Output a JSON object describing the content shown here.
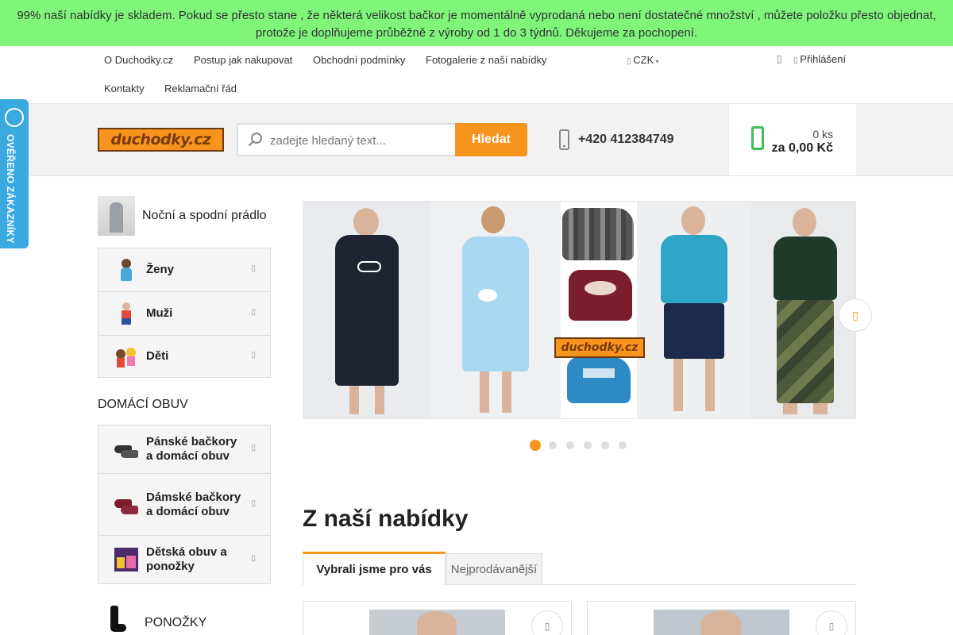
{
  "notice": {
    "line1": "99% naší nabídky je skladem. Pokud se přesto stane , že některá velikost bačkor je momentálně vyprodaná nebo není dostatečné množství , můžete položku přesto objednat,",
    "line2": "protože je doplňujeme průběžně z výroby od 1 do 3 týdnů. Děkujeme za pochopení."
  },
  "topnav": {
    "links": [
      "O Duchodky.cz",
      "Postup jak nakupovat",
      "Obchodní podmínky",
      "Fotogalerie z naší nabídky",
      "Kontakty",
      "Reklamační řád"
    ],
    "currency": "CZK",
    "login": "Přihlášení"
  },
  "header": {
    "logo_text": "duchodky.cz",
    "search_placeholder": "zadejte hledaný text...",
    "search_button": "Hledat",
    "phone": "+420 412384749",
    "cart_count": "0 ks",
    "cart_total": "za 0,00 Kč"
  },
  "badge": {
    "text": "OVĚŘENO ZÁKAZNÍKY"
  },
  "sidebar": {
    "top_category": "Noční a spodní prádlo",
    "group1": [
      {
        "label": "Ženy"
      },
      {
        "label": "Muži"
      },
      {
        "label": "Děti"
      }
    ],
    "section2_title": "DOMÁCÍ OBUV",
    "group2": [
      {
        "label": "Pánské bačkory a domácí obuv"
      },
      {
        "label": "Dámské bačkory a domácí obuv"
      },
      {
        "label": "Dětská obuv a ponožky"
      }
    ],
    "section3_title": "PONOŽKY"
  },
  "slider": {
    "logo_text": "duchodky.cz",
    "slide_count": 6,
    "active_slide": 1
  },
  "offers": {
    "title": "Z naší nabídky",
    "tabs": [
      "Vybrali jsme pro vás",
      "Nejprodávanější"
    ]
  },
  "colors": {
    "accent": "#f7941d",
    "notice_bg": "#7ff57a",
    "cart_icon": "#3cbf5a",
    "badge_bg": "#3aa9e0"
  }
}
